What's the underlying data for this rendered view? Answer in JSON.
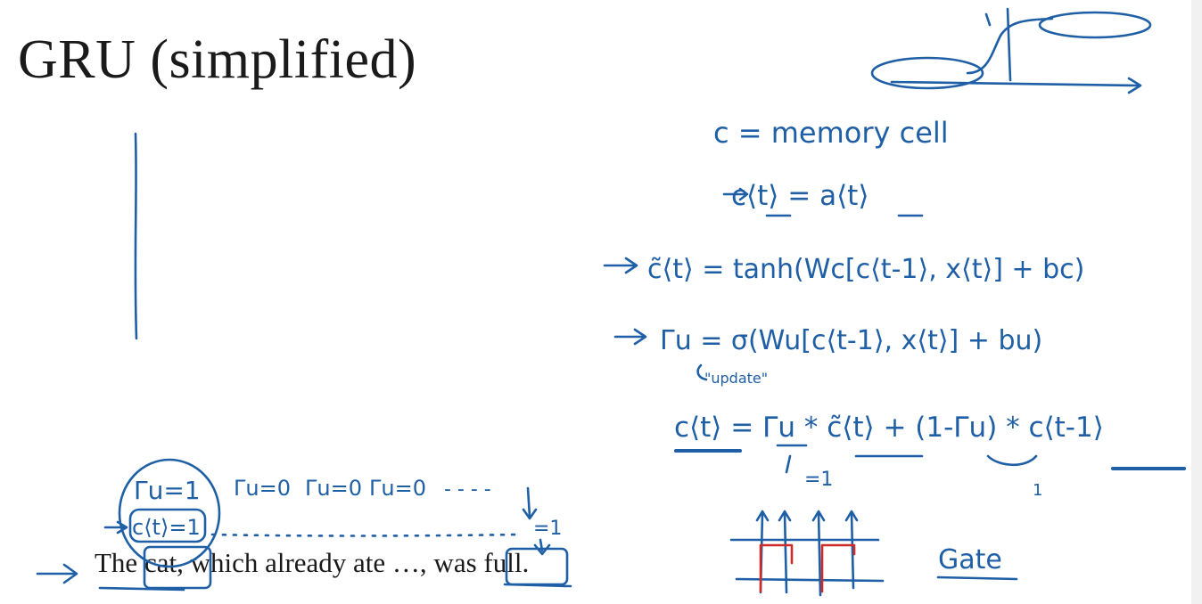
{
  "slide": {
    "title": "GRU (simplified)",
    "sentence": "The cat, which already ate …, was full."
  },
  "notes": {
    "def_memory": "c = memory cell",
    "eq_c_eq_a": "c⟨t⟩ = a⟨t⟩",
    "eq_candidate": "c̃⟨t⟩ = tanh(Wc[c⟨t-1⟩, x⟨t⟩] + bc)",
    "eq_update_gate": "Γu = σ(Wu[c⟨t-1⟩, x⟨t⟩] + bu)",
    "update_note": "\"update\"",
    "eq_c_update": "c⟨t⟩ = Γu * c̃⟨t⟩ + (1-Γu) * c⟨t-1⟩",
    "gate_eq_one": "=1",
    "one_minus_val": "1",
    "gate_label": "Gate",
    "gu_one": "Γu=1",
    "gu_zero_1": "Γu=0",
    "gu_zero_2": "Γu=0",
    "gu_zero_3": "Γu=0",
    "dots": "- - - -",
    "c_one": "c⟨t⟩=1",
    "arrow_one": "=1"
  },
  "colors": {
    "ink": "#1f5fa6",
    "gate_red": "#d02b2b",
    "text": "#1a1a1a"
  }
}
